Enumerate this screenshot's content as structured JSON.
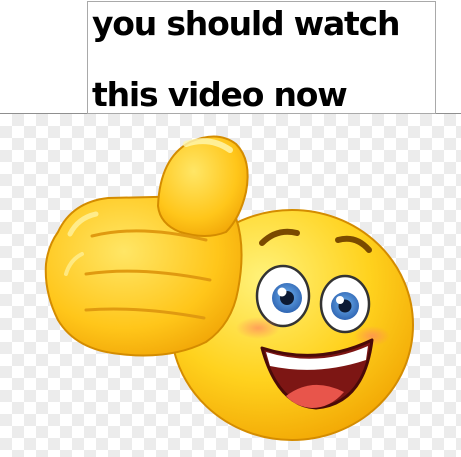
{
  "caption": {
    "line1": "you should watch",
    "line2": "this video now"
  },
  "image": {
    "icon": "thumbs-up-smiley-emoji-icon",
    "background": "transparency-checkerboard",
    "colors": {
      "face_light": "#ffe45a",
      "face_dark": "#f2a300",
      "outline": "#d08a00",
      "eye_iris": "#3a78c9",
      "mouth": "#8a1a16",
      "tongue": "#e8554b",
      "cheek": "#ff9a66"
    }
  }
}
